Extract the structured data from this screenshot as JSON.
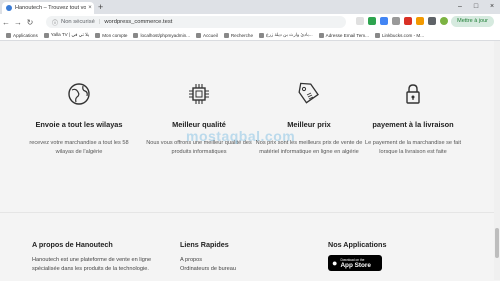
{
  "browser": {
    "tab_title": "Hanoutech – Trouvez tout vos c...",
    "tab_close": "×",
    "new_tab": "+",
    "address": {
      "security_label": "Non sécurisé",
      "separator": "|",
      "url": "wordpress_commerce.test"
    },
    "update_label": "Mettre à jour",
    "bookmarks": [
      "Applications",
      "Yalla TV | يلا تي في",
      "Mon compte",
      "localhost/phpmyadmin...",
      "Accueil",
      "Recherche",
      "بادئ وارث بن ديلة زرع...",
      "Adresse Email Tem...",
      "Linkbucks.com - M..."
    ]
  },
  "features": [
    {
      "title": "Envoie a tout les wilayas",
      "text": "recevez votre marchandise a tout les 58 wilayas de l'algérie"
    },
    {
      "title": "Meilleur qualité",
      "text": "Nous vous offrons une meilleur qualité des produits informatiques"
    },
    {
      "title": "Meilleur prix",
      "text": "Nos prix sont les meilleurs prix de vente de matériel informatique en ligne en algérie"
    },
    {
      "title": "payement à la livraison",
      "text": "Le payement de la marchandise se fait lorsque la livraison est faite"
    }
  ],
  "footer": {
    "about": {
      "title": "A propos de Hanoutech",
      "text": "Hanoutech est une plateforme de vente en ligne spécialisée dans les produits de la technologie."
    },
    "links": {
      "title": "Liens Rapides",
      "items": [
        "A propos",
        "Ordinateurs de bureau"
      ]
    },
    "apps": {
      "title": "Nos Applications",
      "badge_small": "Download on the",
      "badge_big": "App Store"
    }
  },
  "colors": {
    "page_bg": "#f4f4f4",
    "icon_stroke": "#333333",
    "accent_green": "#1e7e34"
  }
}
